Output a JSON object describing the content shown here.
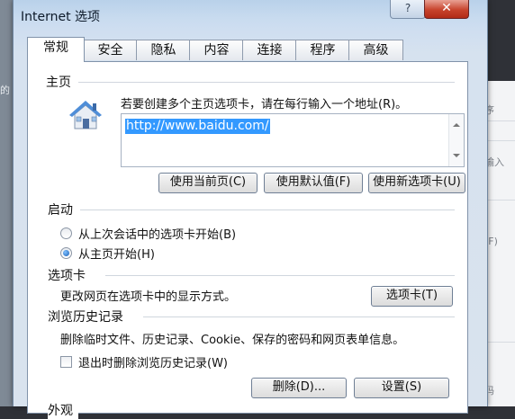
{
  "window": {
    "title": "Internet 选项",
    "help_label": "?",
    "close_label": "✕"
  },
  "tabs": [
    {
      "label": "常规",
      "active": true
    },
    {
      "label": "安全"
    },
    {
      "label": "隐私"
    },
    {
      "label": "内容"
    },
    {
      "label": "连接"
    },
    {
      "label": "程序"
    },
    {
      "label": "高级"
    }
  ],
  "homepage": {
    "group_title": "主页",
    "hint": "若要创建多个主页选项卡，请在每行输入一个地址(R)。",
    "url": "http://www.baidu.com/",
    "icon": "house-icon",
    "buttons": {
      "use_current": "使用当前页(C)",
      "use_default": "使用默认值(F)",
      "use_new_tab": "使用新选项卡(U)"
    }
  },
  "startup": {
    "group_title": "启动",
    "option_last_session": "从上次会话中的选项卡开始(B)",
    "option_homepage": "从主页开始(H)",
    "selected": "option_homepage"
  },
  "tabs_section": {
    "group_title": "选项卡",
    "description": "更改网页在选项卡中的显示方式。",
    "button": "选项卡(T)"
  },
  "history": {
    "group_title": "浏览历史记录",
    "description": "删除临时文件、历史记录、Cookie、保存的密码和网页表单信息。",
    "checkbox_label": "退出时删除浏览历史记录(W)",
    "checked": false,
    "delete_button": "删除(D)...",
    "settings_button": "设置(S)"
  },
  "next_group_partial": "外观",
  "background": {
    "left_text": "的",
    "right_texts": [
      "程序",
      "行输入",
      "直(F)",
      "密码"
    ]
  },
  "colors": {
    "selection": "#3399ff",
    "close_red": "#c7432c",
    "frame": "#b9d1ea"
  }
}
